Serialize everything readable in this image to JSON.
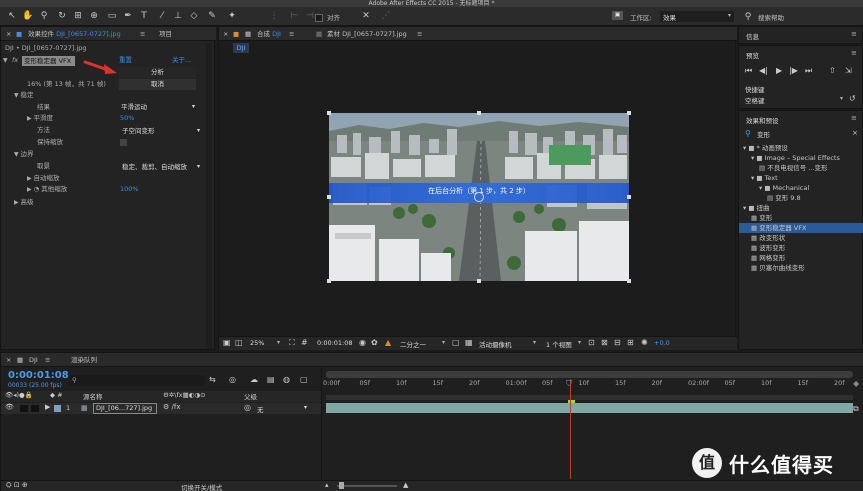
{
  "window_title": "Adobe After Effects CC 2015 - 无标题项目 *",
  "toolbar": {
    "align_label": "对齐",
    "workspace_label": "工作区:",
    "workspace_value": "效果",
    "search_help": "搜索帮助"
  },
  "effects_panel": {
    "tab_label": "效果控件",
    "tab_file": "DJI_[0657-0727].jpg",
    "tab_project": "项目",
    "breadcrumb": "DJI • DJI_[0657-0727].jpg",
    "fx_name": "变形稳定器 VFX",
    "reset": "重置",
    "about": "关于...",
    "analyze": "分析",
    "cancel": "取消",
    "status": "16% (第 13 帧，共 71 帧)",
    "stabilize": "稳定",
    "result_label": "结果",
    "result_value": "平滑运动",
    "smoothness_label": "平滑度",
    "smoothness_value": "50%",
    "method_label": "方法",
    "method_value": "子空间变形",
    "keep_scale_label": "保持缩放",
    "borders": "边界",
    "framing_label": "取景",
    "framing_value": "稳定、裁剪、自动缩放",
    "auto_scale_label": "自动缩放",
    "extra_scale_label": "其他缩放",
    "extra_scale_value": "100%",
    "advanced": "高级"
  },
  "comp_panel": {
    "tab_comp_prefix": "合成",
    "tab_comp_name": "DJI",
    "tab_footage": "素材 DJI_[0657-0727].jpg",
    "comp_chip": "DJI",
    "analyzing_text": "在后台分析（第 1 步，共 2 步）",
    "zoom": "25%",
    "timecode": "0:00:01:08",
    "resolution": "二分之一",
    "camera": "活动摄像机",
    "views": "1 个视图",
    "exposure": "+0.0"
  },
  "right_panels": {
    "info": "信息",
    "preview": "预览",
    "shortcut_label": "快捷键",
    "shortcut_value": "空格键",
    "effects_presets": "效果和预设",
    "search_value": "变形",
    "tree": [
      {
        "indent": 0,
        "label": "* 动画预设",
        "type": "folder",
        "open": true
      },
      {
        "indent": 1,
        "label": "Image – Special Effects",
        "type": "folder",
        "open": true
      },
      {
        "indent": 2,
        "label": "不良电视信号 ...变形",
        "type": "preset"
      },
      {
        "indent": 1,
        "label": "Text",
        "type": "folder",
        "open": true
      },
      {
        "indent": 2,
        "label": "Mechanical",
        "type": "folder",
        "open": true
      },
      {
        "indent": 3,
        "label": "变形 9.8",
        "type": "preset"
      },
      {
        "indent": 0,
        "label": "扭曲",
        "type": "folder",
        "open": true
      },
      {
        "indent": 1,
        "label": "变形",
        "type": "effect"
      },
      {
        "indent": 1,
        "label": "变形稳定器 VFX",
        "type": "effect",
        "selected": true
      },
      {
        "indent": 1,
        "label": "改变形状",
        "type": "effect"
      },
      {
        "indent": 1,
        "label": "波形变形",
        "type": "effect"
      },
      {
        "indent": 1,
        "label": "网格变形",
        "type": "effect"
      },
      {
        "indent": 1,
        "label": "贝塞尔曲线变形",
        "type": "effect"
      }
    ]
  },
  "timeline": {
    "tab_comp": "DJI",
    "tab_render": "渲染队列",
    "timecode": "0:00:01:08",
    "frame_info": "00033 (25.00 fps)",
    "col_source": "源名称",
    "col_parent": "父级",
    "layer_index": "1",
    "layer_name": "DJI_[06...727].jpg",
    "parent_value": "无",
    "toggle_label": "切换开关/模式",
    "ruler": [
      "0:00f",
      "05f",
      "10f",
      "15f",
      "20f",
      "01:00f",
      "05f",
      "10f",
      "15f",
      "20f",
      "02:00f",
      "05f",
      "10f",
      "15f",
      "20f"
    ]
  },
  "watermark": {
    "text": "什么值得买",
    "badge": "值"
  },
  "colors": {
    "accent_blue": "#3c8ee6",
    "selection_blue": "#2a5a9a",
    "red_arrow": "#e0322a",
    "layer_bar": "#7fa8a3"
  }
}
